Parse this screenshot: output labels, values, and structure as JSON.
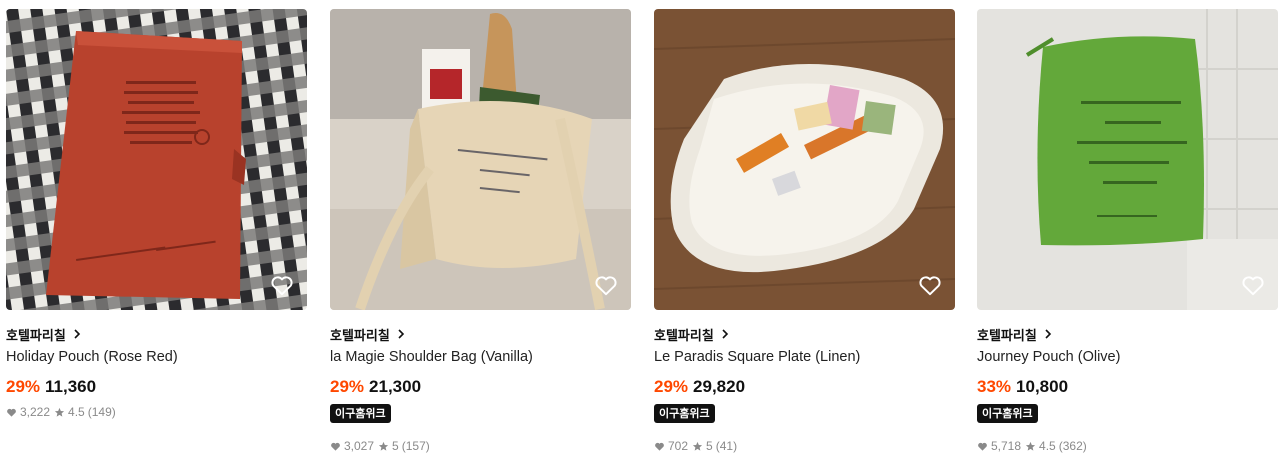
{
  "products": [
    {
      "brand": "호텔파리칠",
      "name": "Holiday Pouch (Rose Red)",
      "discount": "29%",
      "price": "11,360",
      "badge": "",
      "likes": "3,222",
      "rating": "4.5",
      "reviews": "(149)"
    },
    {
      "brand": "호텔파리칠",
      "name": "la Magie Shoulder Bag (Vanilla)",
      "discount": "29%",
      "price": "21,300",
      "badge": "이구홈위크",
      "likes": "3,027",
      "rating": "5",
      "reviews": "(157)"
    },
    {
      "brand": "호텔파리칠",
      "name": "Le Paradis Square Plate (Linen)",
      "discount": "29%",
      "price": "29,820",
      "badge": "이구홈위크",
      "likes": "702",
      "rating": "5",
      "reviews": "(41)"
    },
    {
      "brand": "호텔파리칠",
      "name": "Journey Pouch (Olive)",
      "discount": "33%",
      "price": "10,800",
      "badge": "이구홈위크",
      "likes": "5,718",
      "rating": "4.5",
      "reviews": "(362)"
    }
  ],
  "colors": {
    "discount": "#ff4800",
    "badge_bg": "#111111",
    "stats": "#8a8a8a"
  },
  "icons": {
    "wishlist": "heart-outline-icon",
    "brand_link": "chevron-right-icon",
    "likes": "heart-filled-icon",
    "rating": "star-icon"
  }
}
